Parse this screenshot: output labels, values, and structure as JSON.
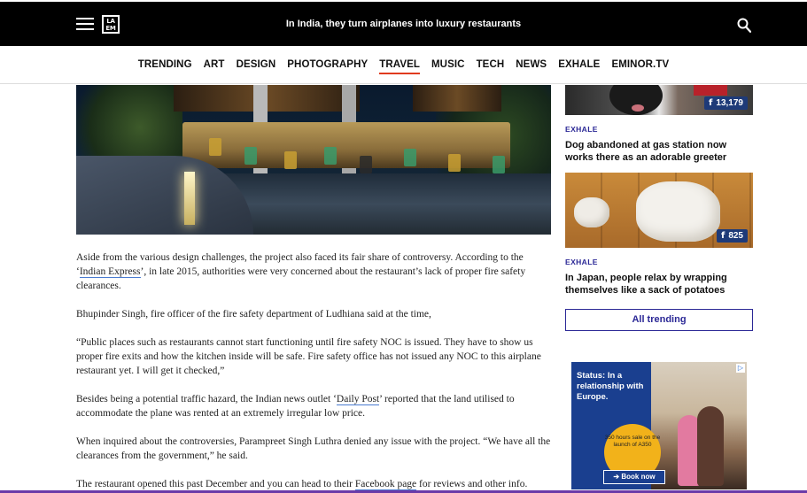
{
  "header": {
    "logo_text": "LA EM",
    "title": "In India, they turn airplanes into luxury restaurants"
  },
  "nav": {
    "items": [
      "TRENDING",
      "ART",
      "DESIGN",
      "PHOTOGRAPHY",
      "TRAVEL",
      "MUSIC",
      "TECH",
      "NEWS",
      "EXHALE",
      "EMINOR.TV"
    ],
    "active": "TRAVEL"
  },
  "article": {
    "p1_a": "Aside from the various design challenges, the project also faced its fair share of controversy. According to the ‘",
    "p1_link": "Indian Express",
    "p1_b": "’, in late 2015, authorities were very concerned about the restaurant’s lack of proper fire safety clearances.",
    "p2": "Bhupinder Singh, fire officer of the fire safety department of Ludhiana said at the time,",
    "p3": "“Public places such as restaurants cannot start functioning until fire safety NOC is issued. They have to show us proper fire exits and how the kitchen inside will be safe. Fire safety office has not issued any NOC to this airplane restaurant yet. I will get it checked,”",
    "p4_a": "Besides being a potential traffic hazard, the Indian news outlet ‘",
    "p4_link": "Daily Post",
    "p4_b": "’ reported that the land utilised to accommodate the plane was rented at an extremely irregular low price.",
    "p5": "When inquired about the controversies, Parampreet Singh Luthra denied any issue with the project.  “We have all the clearances from the government,” he said.",
    "p6_a": "The restaurant opened this past December and you can head to their ",
    "p6_link": "Facebook page",
    "p6_b": " for reviews and other info."
  },
  "sidebar": {
    "card1": {
      "shares": "13,179",
      "category": "EXHALE",
      "headline": "Dog abandoned at gas station now works there as an adorable greeter"
    },
    "card2": {
      "shares": "825",
      "category": "EXHALE",
      "headline": "In Japan, people relax by wrapping themselves like a sack of potatoes"
    },
    "all_trending_label": "All trending"
  },
  "ad": {
    "status_text": "Status: In a relationship with Europe.",
    "badge_text": "350 hours sale on the launch of A350",
    "cta": "Book now",
    "adchoice": "▷"
  },
  "colors": {
    "accent": "#2b2896",
    "active_underline": "#e03a1e",
    "facebook": "#1e3a78",
    "link_underline": "#4a7bd0"
  }
}
